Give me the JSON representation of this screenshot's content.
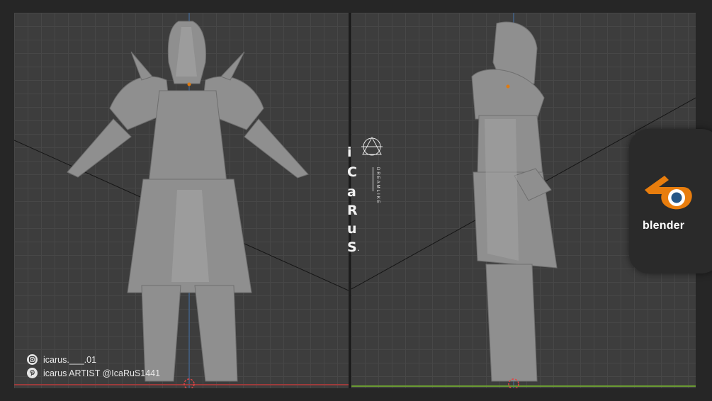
{
  "branding": {
    "letters": [
      "i",
      "C",
      "a",
      "R",
      "u",
      "S",
      "."
    ],
    "tagline": "DREAMLIKE"
  },
  "social": {
    "instagram_handle": "icarus.___.01",
    "pinterest_handle": "icarus ARTIST @IcaRuS1441",
    "instagram_icon": "instagram-icon",
    "pinterest_icon": "pinterest-icon"
  },
  "blender_badge": {
    "wordmark": "blender",
    "logo_icon": "blender-logo-icon",
    "accent": "#e87d0d",
    "inner": "#265787"
  },
  "viewports": {
    "front_label": "front-view",
    "side_label": "side-view",
    "x_axis_color": "#9c3b3b",
    "y_axis_color": "#6a9a32",
    "z_axis_color": "#3f6ea6"
  }
}
